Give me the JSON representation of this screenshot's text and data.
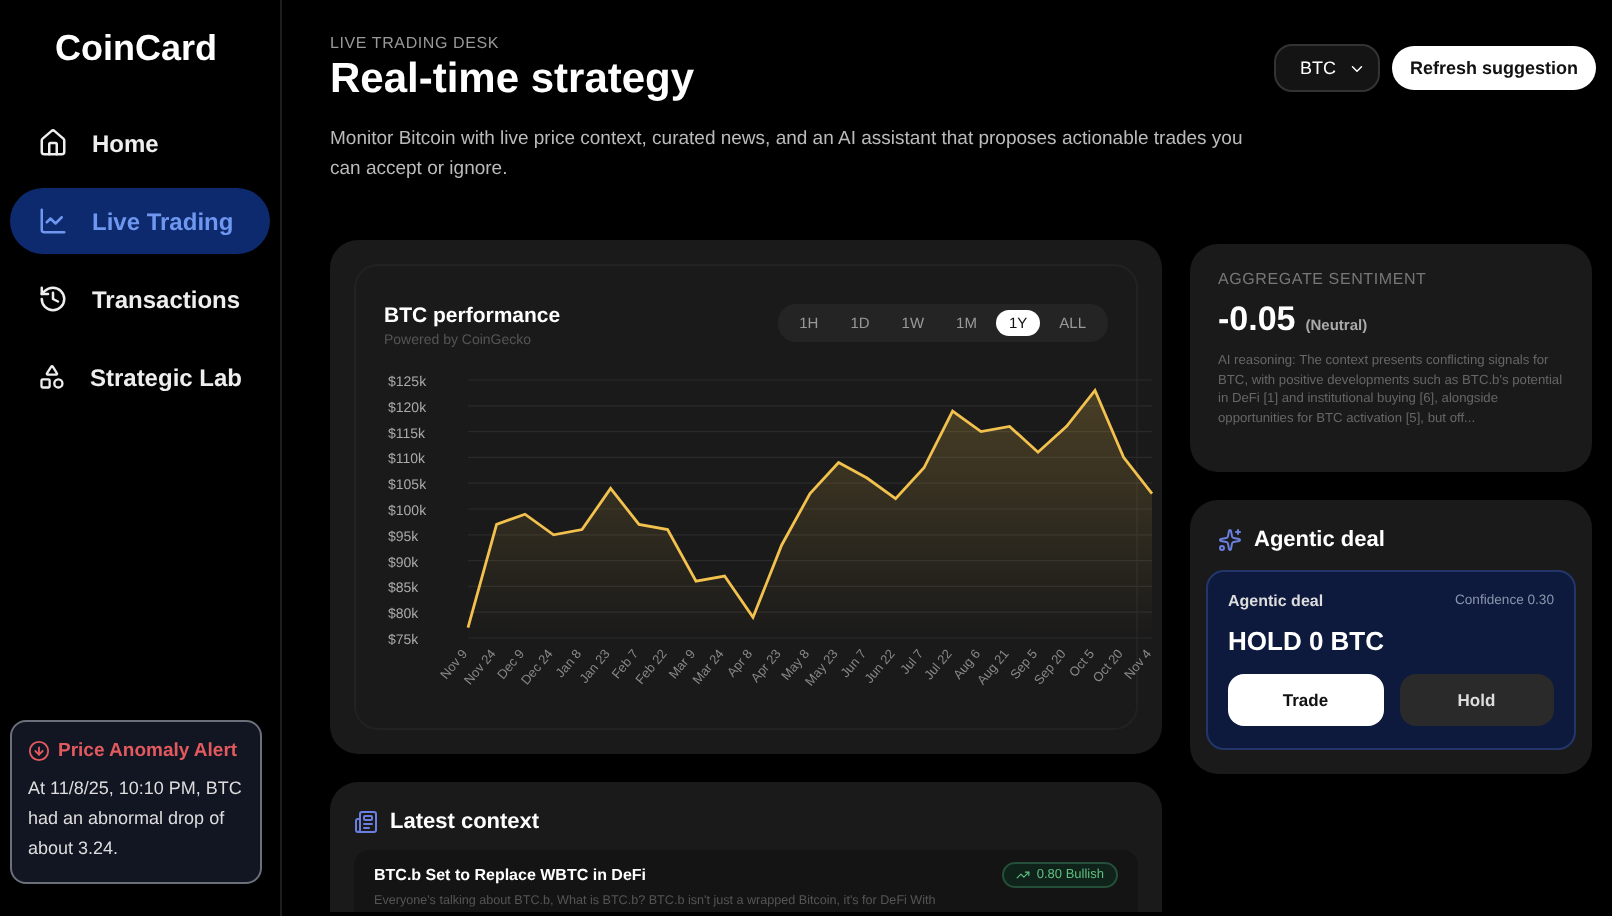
{
  "brand": "CoinCard",
  "sidebar": {
    "items": [
      {
        "label": "Home",
        "selected": false
      },
      {
        "label": "Live Trading",
        "selected": true
      },
      {
        "label": "Transactions",
        "selected": false
      },
      {
        "label": "Strategic Lab",
        "selected": false
      }
    ],
    "alert": {
      "title": "Price Anomaly Alert",
      "body": "At 11/8/25, 10:10 PM, BTC had an abnormal drop of about 3.24."
    }
  },
  "header": {
    "eyebrow": "LIVE TRADING DESK",
    "title": "Real-time strategy",
    "description": "Monitor Bitcoin with live price context, curated news, and an AI assistant that proposes actionable trades you can accept or ignore.",
    "asset_select": "BTC",
    "refresh_button": "Refresh suggestion"
  },
  "performance": {
    "title": "BTC performance",
    "subtitle": "Powered by CoinGecko",
    "ranges": [
      {
        "label": "1H",
        "selected": false
      },
      {
        "label": "1D",
        "selected": false
      },
      {
        "label": "1W",
        "selected": false
      },
      {
        "label": "1M",
        "selected": false
      },
      {
        "label": "1Y",
        "selected": true
      },
      {
        "label": "ALL",
        "selected": false
      }
    ],
    "chart_data": {
      "type": "area",
      "categories": [
        "Nov 9",
        "Nov 24",
        "Dec 9",
        "Dec 24",
        "Jan 8",
        "Jan 23",
        "Feb 7",
        "Feb 22",
        "Mar 9",
        "Mar 24",
        "Apr 8",
        "Apr 23",
        "May 8",
        "May 23",
        "Jun 7",
        "Jun 22",
        "Jul 7",
        "Jul 22",
        "Aug 6",
        "Aug 21",
        "Sep 5",
        "Sep 20",
        "Oct 5",
        "Oct 20",
        "Nov 4"
      ],
      "grid": true,
      "series": [
        {
          "color": "#f2c14e",
          "values": [
            77,
            97,
            99,
            95,
            96,
            104,
            97,
            96,
            86,
            87,
            79,
            93,
            103,
            109,
            106,
            102,
            108,
            119,
            115,
            116,
            111,
            116,
            123,
            110,
            103
          ]
        }
      ],
      "ylim": [
        75,
        125
      ],
      "yticks": [
        {
          "value": 75,
          "label": "$75k"
        },
        {
          "value": 80,
          "label": "$80k"
        },
        {
          "value": 85,
          "label": "$85k"
        },
        {
          "value": 90,
          "label": "$90k"
        },
        {
          "value": 95,
          "label": "$95k"
        },
        {
          "value": 100,
          "label": "$100k"
        },
        {
          "value": 105,
          "label": "$105k"
        },
        {
          "value": 110,
          "label": "$110k"
        },
        {
          "value": 115,
          "label": "$115k"
        },
        {
          "value": 120,
          "label": "$120k"
        },
        {
          "value": 125,
          "label": "$125k"
        }
      ]
    }
  },
  "sentiment": {
    "label": "AGGREGATE SENTIMENT",
    "score": "-0.05",
    "verdict": "(Neutral)",
    "reasoning": "AI reasoning: The context presents conflicting signals for BTC, with positive developments such as BTC.b's potential in DeFi [1] and institutional buying [6], alongside opportunities for BTC activation [5], but off..."
  },
  "agentic": {
    "title": "Agentic deal",
    "deal_label": "Agentic deal",
    "confidence": "Confidence 0.30",
    "action": "HOLD 0 BTC",
    "buttons": [
      {
        "label": "Trade",
        "kind": "primary"
      },
      {
        "label": "Hold",
        "kind": "secondary"
      }
    ]
  },
  "context": {
    "title": "Latest context",
    "items": [
      {
        "headline": "BTC.b Set to Replace WBTC in DeFi",
        "badge": "0.80 Bullish",
        "excerpt": "Everyone's talking about BTC.b, What is BTC.b? BTC.b isn't just a wrapped Bitcoin, it's for DeFi With"
      }
    ]
  }
}
